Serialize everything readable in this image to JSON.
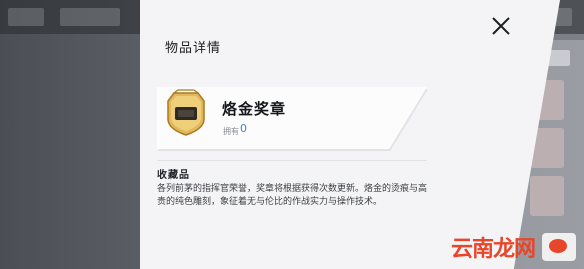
{
  "modal": {
    "title": "物品详情",
    "item": {
      "name": "烙金奖章",
      "owned_label": "拥有",
      "owned_count": "0",
      "icon": "gold-medal-icon"
    },
    "section_title": "收藏品",
    "description": "各列前茅的指挥官荣誉，奖章将根据获得次数更新。烙金的烫痕与高贵的纯色雕刻，象征着无与伦比的作战实力与操作技术。",
    "close_icon": "close-icon"
  },
  "watermark": {
    "text": "云南龙网"
  },
  "colors": {
    "accent": "#3b7fd6",
    "medal_gold": "#d8a94a",
    "watermark": "#e8462a"
  }
}
